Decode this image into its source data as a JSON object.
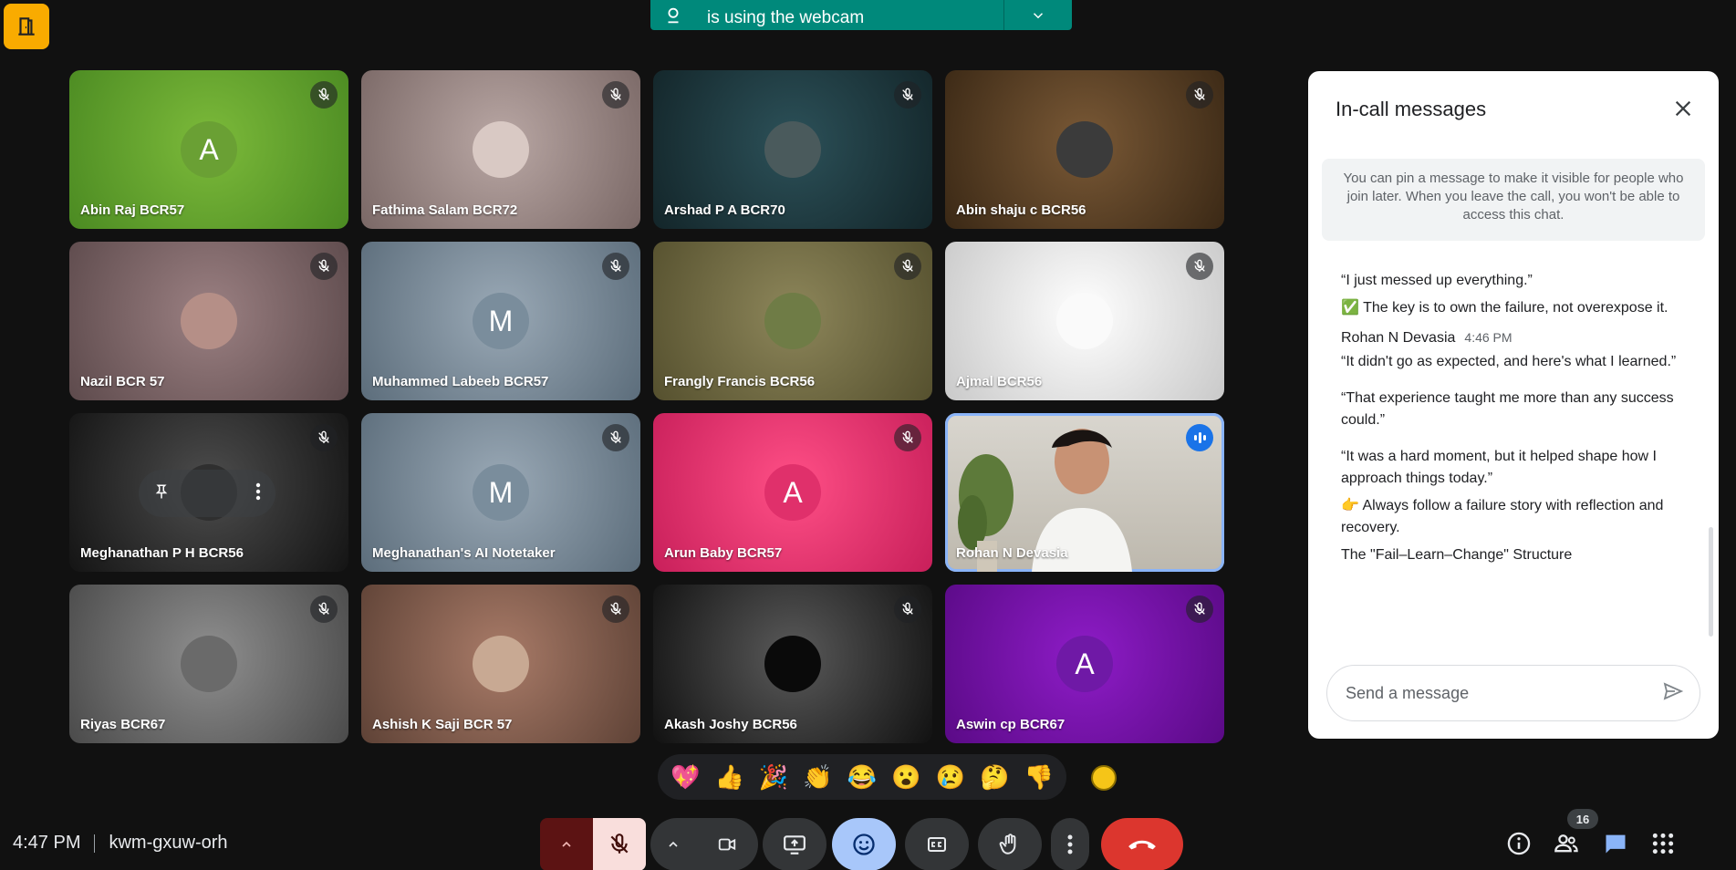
{
  "banner": {
    "text": "is using the webcam"
  },
  "tiles": [
    {
      "name": "Abin Raj BCR57",
      "avatar": "A",
      "bg": "radial-gradient(circle at 50% 45%, #7cba3a, #4b8a22)",
      "avatarBg": "#6aa034"
    },
    {
      "name": "Fathima Salam BCR72",
      "avatar": "",
      "bg": "radial-gradient(circle at 50% 45%, #b9a7a4, #7a6866)",
      "avatarBg": "#d9c9c4"
    },
    {
      "name": "Arshad P A BCR70",
      "avatar": "",
      "bg": "radial-gradient(circle at 50% 45%, #2c5159, #132529)",
      "avatarBg": "#4a5a5c"
    },
    {
      "name": "Abin shaju c BCR56",
      "avatar": "",
      "bg": "radial-gradient(circle at 50% 45%, #7a5936, #3a2815)",
      "avatarBg": "#3b3b3b"
    },
    {
      "name": "Nazil BCR 57",
      "avatar": "",
      "bg": "radial-gradient(circle at 50% 45%, #9b8082, #5d4a4c)",
      "avatarBg": "#b58f87"
    },
    {
      "name": "Muhammed Labeeb BCR57",
      "avatar": "M",
      "bg": "radial-gradient(circle at 50% 45%, #9aa9b6, #5c6d7b)",
      "avatarBg": "#7a8d9c"
    },
    {
      "name": "Frangly Francis BCR56",
      "avatar": "",
      "bg": "radial-gradient(circle at 50% 45%, #8d865a, #55502e)",
      "avatarBg": "#6f7c46"
    },
    {
      "name": "Ajmal BCR56",
      "avatar": "",
      "bg": "radial-gradient(circle at 50% 45%, #ffffff, #c9c9c9)",
      "avatarBg": "#fafafa"
    },
    {
      "name": "Meghanathan P H BCR56",
      "avatar": "",
      "bg": "radial-gradient(circle at 50% 45%, #4d4d4d, #141414)",
      "avatarBg": "#2f2f2f"
    },
    {
      "name": "Meghanathan's AI Notetaker",
      "avatar": "M",
      "bg": "radial-gradient(circle at 50% 45%, #9aa9b6, #5c6d7b)",
      "avatarBg": "#7a8d9c"
    },
    {
      "name": "Arun Baby BCR57",
      "avatar": "A",
      "bg": "radial-gradient(circle at 50% 45%, #ff4f86, #c81f5a)",
      "avatarBg": "#e0306b"
    },
    {
      "name": "Rohan N Devasia",
      "avatar": "",
      "bg": "linear-gradient(180deg, #d9d6cf, #bdb8ad)",
      "avatarBg": "",
      "speaking": true
    },
    {
      "name": "Riyas BCR67",
      "avatar": "",
      "bg": "radial-gradient(circle at 50% 45%, #8f8f8f, #4a4a4a)",
      "avatarBg": "#6a6a6a"
    },
    {
      "name": "Ashish K Saji BCR 57",
      "avatar": "",
      "bg": "radial-gradient(circle at 50% 45%, #a97b68, #5e4236)",
      "avatarBg": "#c8a993"
    },
    {
      "name": "Akash Joshy BCR56",
      "avatar": "",
      "bg": "radial-gradient(circle at 50% 45%, #5a5a5a, #111111)",
      "avatarBg": "#0a0a0a"
    },
    {
      "name": "Aswin cp BCR67",
      "avatar": "A",
      "bg": "radial-gradient(circle at 50% 45%, #8e1cc7, #5a0a86)",
      "avatarBg": "#6f19a6"
    }
  ],
  "reactions": [
    "💖",
    "👍",
    "🎉",
    "👏",
    "😂",
    "😮",
    "😢",
    "🤔",
    "👎"
  ],
  "bottom": {
    "time": "4:47 PM",
    "meeting_code": "kwm-gxuw-orh",
    "participants_count": "16"
  },
  "panel": {
    "title": "In-call messages",
    "pin_info": "You can pin a message to make it visible for people who join later. When you leave the call, you won't be able to access this chat.",
    "msg1": "“I just messed up everything.”",
    "msg2": "✅ The key is to own the failure, not overexpose it.",
    "sender_name": "Rohan N Devasia",
    "sender_time": "4:46 PM",
    "msg3": "“It didn't go as expected, and here's what I learned.”",
    "msg4": "“That experience taught me more than any success could.”",
    "msg5": "“It was a hard moment, but it helped shape how I approach things today.”",
    "msg6": "👉 Always follow a failure story with reflection and recovery.",
    "msg7": "The \"Fail–Learn–Change\" Structure",
    "input_placeholder": "Send a message"
  }
}
